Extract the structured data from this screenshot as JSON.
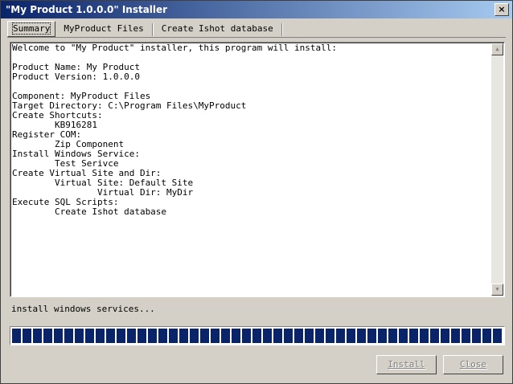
{
  "window": {
    "title": "\"My Product 1.0.0.0\" Installer"
  },
  "tabs": [
    {
      "label": "Summary",
      "active": true
    },
    {
      "label": "MyProduct Files",
      "active": false
    },
    {
      "label": "Create Ishot database",
      "active": false
    }
  ],
  "summary_text": "Welcome to \"My Product\" installer, this program will install:\n\nProduct Name: My Product\nProduct Version: 1.0.0.0\n\nComponent: MyProduct Files\nTarget Directory: C:\\Program Files\\MyProduct\nCreate Shortcuts:\n        KB916281\nRegister COM:\n        Zip Component\nInstall Windows Service:\n        Test Serivce\nCreate Virtual Site and Dir:\n        Virtual Site: Default Site\n                Virtual Dir: MyDir\nExecute SQL Scripts:\n        Create Ishot database",
  "status_text": "install windows services...",
  "progress": {
    "fraction": 1.0,
    "color": "#0a246a"
  },
  "buttons": {
    "install_label": "Install",
    "close_label": "Close",
    "enabled": false
  },
  "icons": {
    "scroll_up": "▲",
    "scroll_down": "▼",
    "window_close": "×"
  },
  "colors": {
    "titlebar_start": "#0a246a",
    "titlebar_end": "#a6caf0",
    "face": "#d4d0c8"
  }
}
